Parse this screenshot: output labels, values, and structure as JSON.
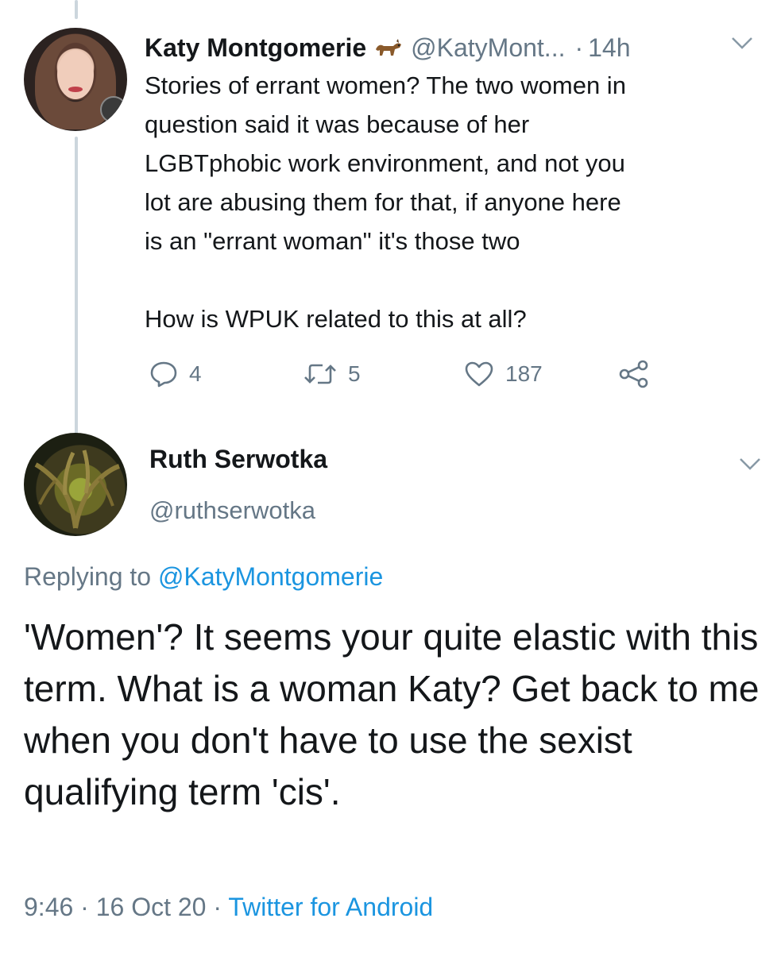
{
  "tweet_katy": {
    "display_name": "Katy Montgomerie",
    "name_emoji": "dog-emoji",
    "handle": "@KatyMont...",
    "separator": "·",
    "time_ago": "14h",
    "text": "Stories of errant women? The two women in\nquestion said it was because of her\nLGBTphobic work environment, and not you\nlot are abusing them for that, if anyone here\nis an \"errant woman\" it's those two\n\nHow is WPUK related to this at all?",
    "actions": {
      "reply_count": "4",
      "retweet_count": "5",
      "like_count": "187"
    }
  },
  "tweet_ruth": {
    "display_name": "Ruth Serwotka",
    "handle": "@ruthserwotka",
    "replying_prefix": "Replying to ",
    "replying_mention": "@KatyMontgomerie",
    "text": "'Women'? It seems your quite elastic with this term. What is a woman Katy? Get back to me when you don't have to use the sexist qualifying term 'cis'.",
    "time": "9:46",
    "sep1": " · ",
    "date": "16 Oct 20",
    "sep2": " · ",
    "source": "Twitter for Android"
  },
  "colors": {
    "text": "#14171a",
    "secondary": "#657786",
    "link": "#1b95e0",
    "thread_line": "#ccd6dd"
  }
}
